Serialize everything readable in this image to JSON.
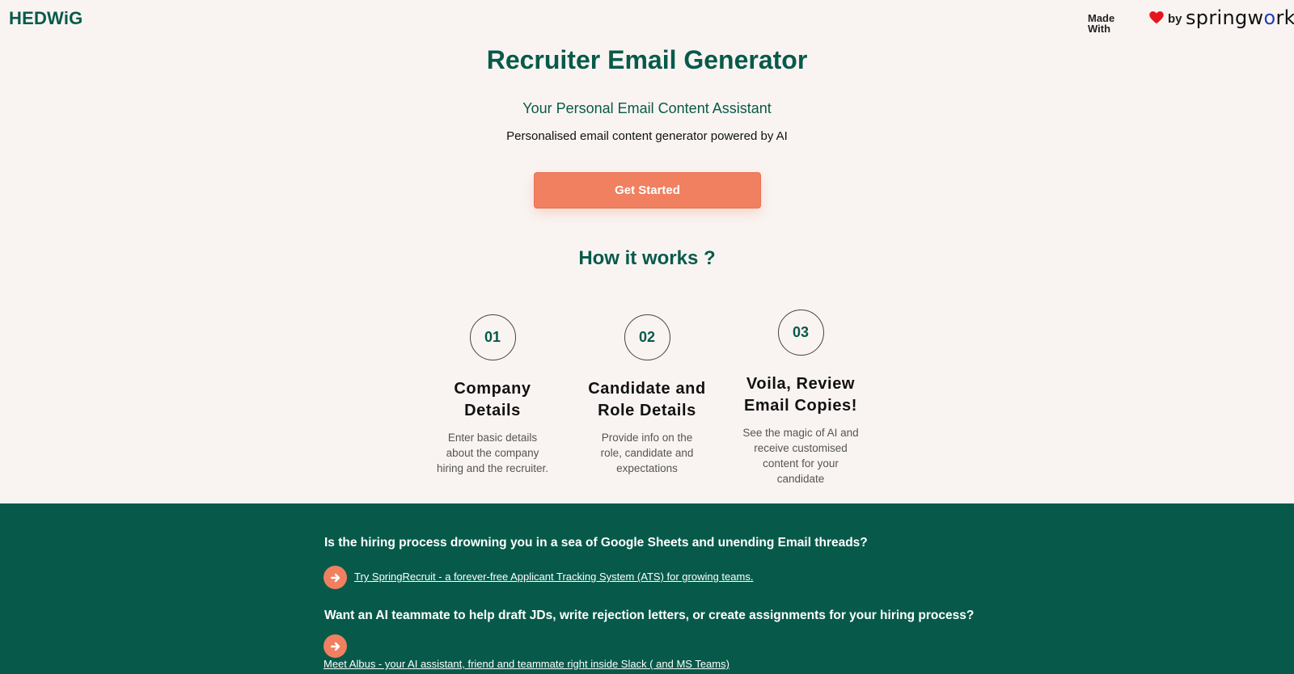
{
  "header": {
    "logo": "HEDWiG",
    "made_with_line1": "Made",
    "made_with_line2": "With",
    "by": "by",
    "brand_part1": "springw",
    "brand_leaf": "o",
    "brand_part2": "rks"
  },
  "hero": {
    "title": "Recruiter Email Generator",
    "subtitle": "Your Personal Email Content Assistant",
    "tagline": "Personalised email content generator powered by AI",
    "cta_label": "Get Started"
  },
  "how_it_works": {
    "heading": "How it works ?",
    "steps": [
      {
        "number": "01",
        "title_line1": "Company",
        "title_line2": "Details",
        "desc_line1": "Enter basic details",
        "desc_line2": "about the company",
        "desc_line3": "hiring and the recruiter.",
        "desc_line4": ""
      },
      {
        "number": "02",
        "title_line1": "Candidate and",
        "title_line2": "Role Details",
        "desc_line1": "Provide info on the",
        "desc_line2": "role, candidate and",
        "desc_line3": "expectations",
        "desc_line4": ""
      },
      {
        "number": "03",
        "title_line1": "Voila, Review",
        "title_line2": "Email Copies!",
        "desc_line1": "See the magic of AI and",
        "desc_line2": "receive customised",
        "desc_line3": "content for your",
        "desc_line4": "candidate"
      }
    ]
  },
  "footer": {
    "q1": "Is the hiring process drowning you in a sea of Google Sheets and unending Email threads?",
    "link1": "Try SpringRecruit - a forever-free Applicant Tracking System (ATS) for growing teams.",
    "q2": "Want an AI teammate to help draft JDs, write rejection letters, or create assignments for your hiring process?",
    "link2": "Meet Albus - your AI assistant, friend and teammate right inside Slack ( and MS Teams)"
  },
  "colors": {
    "primary_green": "#075a4a",
    "accent_orange": "#f08060",
    "background": "#f9f4f2",
    "heart_red": "#e8141c"
  },
  "icons": [
    "heart-icon",
    "arrow-right-icon"
  ]
}
